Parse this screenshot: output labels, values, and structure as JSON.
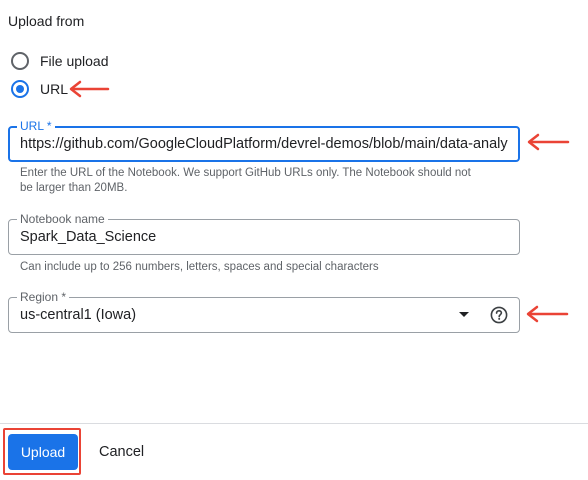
{
  "upload_from": {
    "title": "Upload from",
    "options": [
      {
        "label": "File upload",
        "checked": false
      },
      {
        "label": "URL",
        "checked": true
      }
    ]
  },
  "url_field": {
    "label": "URL *",
    "value": "https://github.com/GoogleCloudPlatform/devrel-demos/blob/main/data-analy",
    "hint_line1": "Enter the URL of the Notebook. We support GitHub URLs only. The Notebook should not",
    "hint_line2": "be larger than 20MB."
  },
  "notebook_field": {
    "label": "Notebook name",
    "value": "Spark_Data_Science",
    "hint": "Can include up to 256 numbers, letters, spaces and special characters"
  },
  "region_field": {
    "label": "Region *",
    "value": "us-central1 (Iowa)",
    "help_icon": "help-circle-icon",
    "dropdown_icon": "caret-down-icon"
  },
  "footer": {
    "upload_label": "Upload",
    "cancel_label": "Cancel"
  },
  "colors": {
    "primary": "#1a73e8",
    "annotation": "#ea4335",
    "text": "#202124",
    "secondary_text": "#5f6368",
    "border": "#9aa0a6"
  }
}
